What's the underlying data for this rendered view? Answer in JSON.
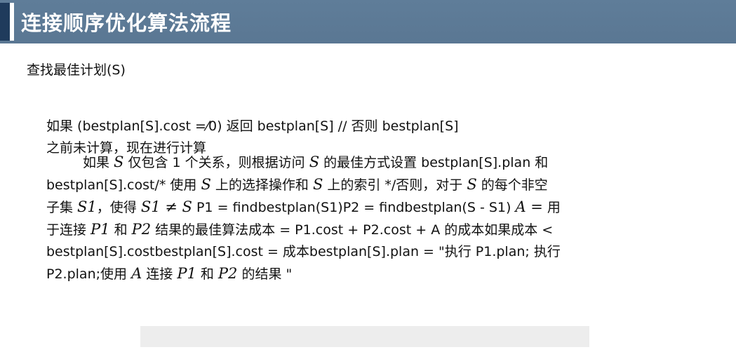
{
  "header": {
    "title": "连接顺序优化算法流程"
  },
  "subtitle": "查找最佳计划(S)",
  "paragraph1": {
    "line1": "如果 (bestplan[S].cost =⁄0) 返回 bestplan[S] // 否则 bestplan[S]",
    "line2": "之前未计算，现在进行计算"
  },
  "body": {
    "line1": {
      "a": "如果 ",
      "m1": "S",
      "b": " 仅包含 1 个关系，则根据访问 ",
      "m2": "S",
      "c": " 的最佳方式设置 bestplan[S].plan 和"
    },
    "line2": {
      "a": "bestplan[S].cost/* 使用 ",
      "m1": "S",
      "b": " 上的选择操作和 ",
      "m2": "S",
      "c": " 上的索引 */否则，对于 ",
      "m3": "S",
      "d": " 的每个非空"
    },
    "line3": {
      "a": "子集 ",
      "m1": "S1",
      "b": "，使得 ",
      "m2": "S1 ≠ S",
      "c": " P1 = findbestplan(S1)P2 = findbestplan(S - S1) ",
      "m3": "A =",
      "d": " 用"
    },
    "line4": {
      "a": "于连接 ",
      "m1": "P1",
      "b": " 和 ",
      "m2": "P2",
      "c": " 结果的最佳算法成本 = P1.cost + P2.cost + A 的成本如果成本 <"
    },
    "line5": "bestplan[S].costbestplan[S].cost = 成本bestplan[S].plan = \"执行 P1.plan; 执行",
    "line6": {
      "a": "P2.plan;使用 ",
      "m1": "A",
      "b": " 连接 ",
      "m2": "P1",
      "c": " 和 ",
      "m3": "P2",
      "d": " 的结果 \""
    }
  },
  "colors": {
    "title_bar": "#5f7d99",
    "title_accent": "#1f3b5c",
    "title_text": "#ffffff",
    "body_text": "#111111"
  }
}
